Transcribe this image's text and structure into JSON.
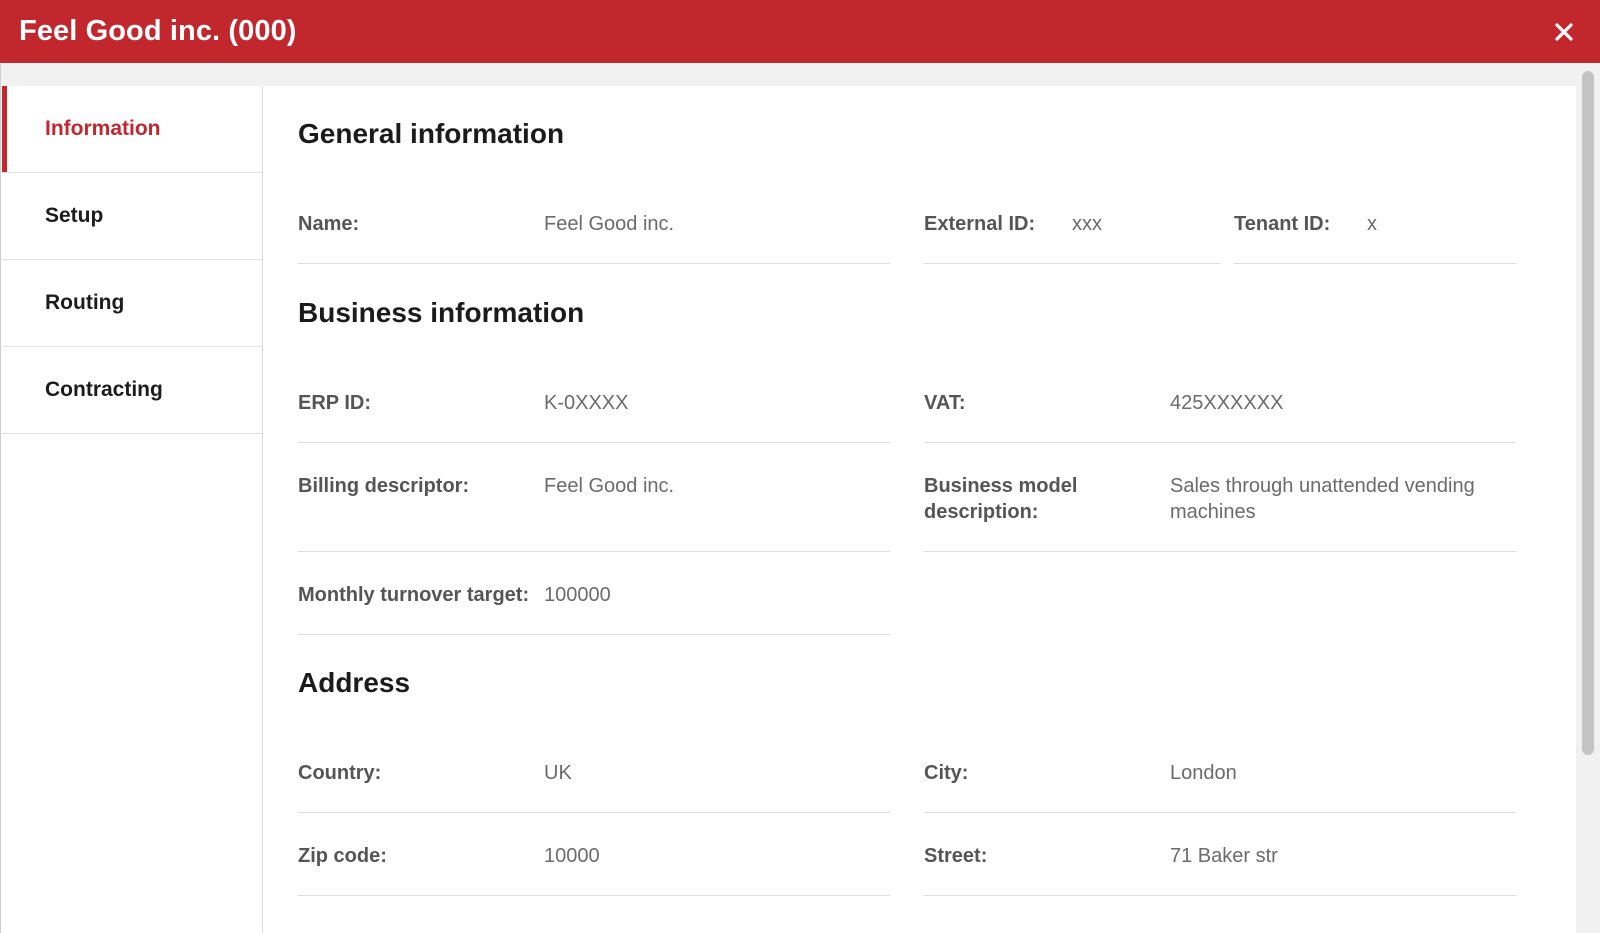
{
  "window": {
    "title": "Feel Good inc. (000)"
  },
  "sidebar": {
    "items": [
      {
        "label": "Information",
        "active": true
      },
      {
        "label": "Setup",
        "active": false
      },
      {
        "label": "Routing",
        "active": false
      },
      {
        "label": "Contracting",
        "active": false
      }
    ]
  },
  "sections": {
    "general": {
      "title": "General information",
      "name_label": "Name:",
      "name_value": "Feel Good inc.",
      "external_id_label": "External ID:",
      "external_id_value": "xxx",
      "tenant_id_label": "Tenant ID:",
      "tenant_id_value": "x"
    },
    "business": {
      "title": "Business information",
      "erp_id_label": "ERP ID:",
      "erp_id_value": "K-0XXXX",
      "vat_label": "VAT:",
      "vat_value": "425XXXXXX",
      "billing_descriptor_label": "Billing descriptor:",
      "billing_descriptor_value": "Feel Good inc.",
      "business_model_label_line1": "Business model",
      "business_model_label_line2": "description:",
      "business_model_value_line1": "Sales through unattended vending",
      "business_model_value_line2": "machines",
      "monthly_turnover_label": "Monthly turnover target:",
      "monthly_turnover_value": "100000"
    },
    "address": {
      "title": "Address",
      "country_label": "Country:",
      "country_value": "UK",
      "city_label": "City:",
      "city_value": "London",
      "zip_label": "Zip code:",
      "zip_value": "10000",
      "street_label": "Street:",
      "street_value": "71 Baker str"
    }
  },
  "colors": {
    "brand": "#c1272d",
    "label": "#555555",
    "value": "#6b6b6b"
  },
  "icons": {
    "close": "close-icon"
  }
}
